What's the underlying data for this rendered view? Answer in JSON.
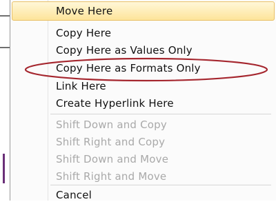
{
  "context_menu": {
    "items": [
      {
        "label": "Move Here",
        "state": "highlighted"
      },
      {
        "label": "Copy Here",
        "state": "enabled"
      },
      {
        "label": "Copy Here as Values Only",
        "state": "enabled"
      },
      {
        "label": "Copy Here as Formats Only",
        "state": "enabled"
      },
      {
        "label": "Link Here",
        "state": "enabled"
      },
      {
        "label": "Create Hyperlink Here",
        "state": "enabled"
      },
      {
        "label": "Shift Down and Copy",
        "state": "disabled"
      },
      {
        "label": "Shift Right and Copy",
        "state": "disabled"
      },
      {
        "label": "Shift Down and Move",
        "state": "disabled"
      },
      {
        "label": "Shift Right and Move",
        "state": "disabled"
      },
      {
        "label": "Cancel",
        "state": "enabled"
      }
    ]
  },
  "annotation": {
    "shape": "ellipse",
    "color": "#a5262e"
  },
  "colors": {
    "highlight_fill": "#fde49a",
    "highlight_border": "#e9c067",
    "disabled_text": "#a9a9a9"
  }
}
